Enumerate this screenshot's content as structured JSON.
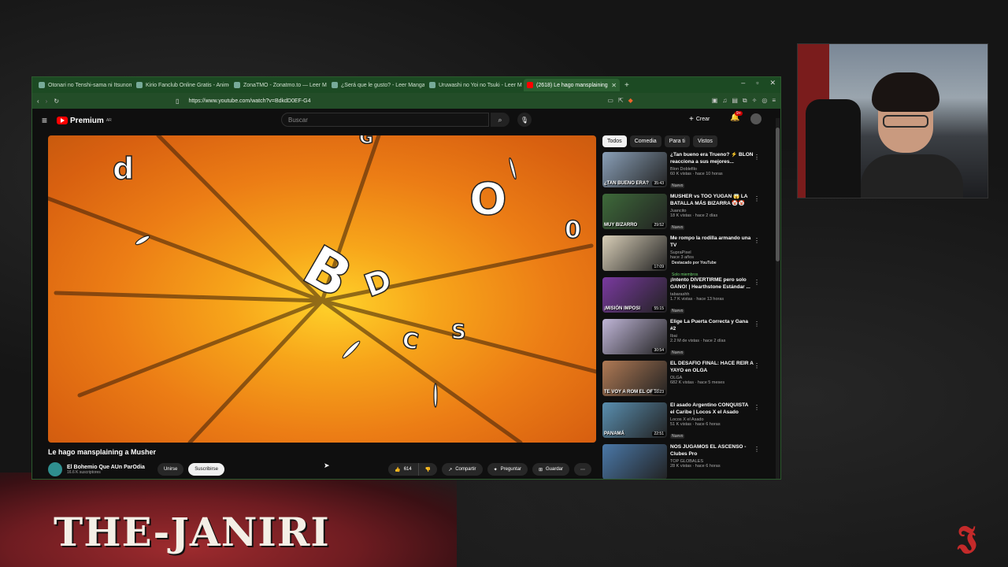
{
  "stream": {
    "brand_text": "THE-JANIRI"
  },
  "browser": {
    "tabs": [
      {
        "label": "Otonari no Tenshi-sama ni Itsunom",
        "favicon": "manga"
      },
      {
        "label": "Kirio Fanclub Online Gratis - AnimeF",
        "favicon": "anime"
      },
      {
        "label": "ZonaTMO - Zonatmo.to — Leer Manga",
        "favicon": "home"
      },
      {
        "label": "¿Será que le gusto? - Leer Manga G",
        "favicon": "home"
      },
      {
        "label": "Uruwashi no Yoi no Tsuki - Leer Man",
        "favicon": "home"
      },
      {
        "label": "(2618) Le hago mansplaining",
        "favicon": "youtube",
        "active": true
      }
    ],
    "url": "https://www.youtube.com/watch?v=BdkdD0EF-G4"
  },
  "youtube": {
    "logo_text": "Premium",
    "logo_region": "AR",
    "search_placeholder": "Buscar",
    "create_label": "Crear",
    "notif_count": "9+",
    "video": {
      "title": "Le hago mansplaining a Musher",
      "channel": "El Bohemio Que AUn ParOdia",
      "subscribers": "16.6 K suscriptores",
      "join_label": "Unirse",
      "subscribe_label": "Suscribirse",
      "likes": "614",
      "share_label": "Compartir",
      "ask_label": "Preguntar",
      "save_label": "Guardar"
    },
    "chips": [
      "Todos",
      "Comedia",
      "Para ti",
      "Vistos"
    ],
    "recommendations": [
      {
        "title": "¿Tan bueno era Trueno? ⚡ BLON reacciona a sus mejores...",
        "channel": "Blon Doblefilo",
        "meta": "60 K vistas · hace 10 horas",
        "badge": "Nuevo",
        "duration": "35:43",
        "color": "#8aa0b8"
      },
      {
        "title": "MUSHER vs TOO YUGAN 😱 LA BATALLA MÁS BIZARRA 🤡🤡",
        "channel": "Juancito",
        "meta": "18 K vistas · hace 2 días",
        "badge": "Nuevo",
        "duration": "29:52",
        "color": "#3e6a3a"
      },
      {
        "title": "Me rompo la rodilla armando una TV",
        "channel": "SupraPixel",
        "meta": "hace 3 años",
        "badge": "Destacado por YouTube",
        "badge2": "Solo miembros",
        "duration": "17:09",
        "color": "#d9cfb8"
      },
      {
        "title": "¡Intento DIVERTIRME pero solo GANO! | Hearthstone Estándar ...",
        "channel": "tabarashh",
        "meta": "1.7 K vistas · hace 13 horas",
        "badge": "Nuevo",
        "duration": "55:15",
        "color": "#7a3aa0"
      },
      {
        "title": "Elige La Puerta Correcta y Gana #2",
        "channel": "Ibai",
        "meta": "2.2 M de vistas · hace 2 días",
        "badge": "Nuevo",
        "duration": "30:54",
        "color": "#c0b6d8"
      },
      {
        "title": "EL DESAFÍO FINAL: HACÉ REÍR A YAYO en OLGA",
        "channel": "OLGA",
        "meta": "682 K vistas · hace 5 meses",
        "badge": "",
        "duration": "10:23",
        "color": "#b07a55"
      },
      {
        "title": "El asado Argentino CONQUISTA el Caribe | Locos X el Asado",
        "channel": "Locos X el Asado",
        "meta": "51 K vistas · hace 6 horas",
        "badge": "Nuevo",
        "duration": "22:51",
        "color": "#5a8fb0"
      },
      {
        "title": "NOS JUGAMOS EL ASCENSO - Clubes Pro",
        "channel": "TOP GLOBALES",
        "meta": "28 K vistas · hace 6 horas",
        "badge": "",
        "duration": "",
        "color": "#4a78a8"
      }
    ],
    "thumb_labels": [
      "¿TAN BUENO ERA?",
      "MUY BIZARRO",
      "",
      "¡MISIÓN IMPOSI",
      "",
      "TE VOY A ROM EL ORTO",
      "PANAMÁ",
      ""
    ]
  }
}
